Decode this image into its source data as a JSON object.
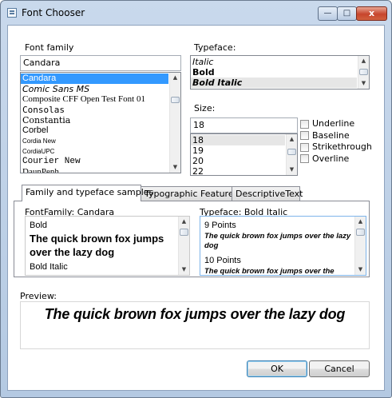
{
  "window": {
    "title": "Font Chooser",
    "minimize_glyph": "—",
    "maximize_glyph": "□",
    "close_glyph": "x"
  },
  "font_family": {
    "label": "Font family",
    "value": "Candara",
    "items": [
      {
        "text": "Candara",
        "font": "\"Liberation Sans\", sans-serif",
        "selected": true
      },
      {
        "text": "Comic Sans MS",
        "font": "\"DejaVu Sans\", sans-serif",
        "selected": false
      },
      {
        "text": "Composite CFF Open Test Font 01",
        "font": "\"Liberation Serif\", serif",
        "selected": false
      },
      {
        "text": "Consolas",
        "font": "\"DejaVu Sans Mono\", monospace",
        "selected": false
      },
      {
        "text": "Constantia",
        "font": "\"DejaVu Serif\", serif",
        "selected": false
      },
      {
        "text": "Corbel",
        "font": "\"Liberation Sans\", sans-serif",
        "selected": false
      },
      {
        "text": "Cordia New",
        "font": "\"Liberation Sans\", sans-serif",
        "selected": false
      },
      {
        "text": "CordiaUPC",
        "font": "\"Liberation Sans\", sans-serif",
        "selected": false
      },
      {
        "text": "Courier New",
        "font": "\"Liberation Mono\", monospace",
        "selected": false
      },
      {
        "text": "DaunPenh",
        "font": "\"Liberation Serif\", serif",
        "selected": false
      }
    ]
  },
  "typeface": {
    "label": "Typeface:",
    "items": [
      {
        "text": "Italic",
        "style": "italic",
        "selected": false
      },
      {
        "text": "Bold",
        "style": "bold",
        "selected": false
      },
      {
        "text": "Bold Italic",
        "style": "bolditalic",
        "selected": true
      }
    ]
  },
  "size": {
    "label": "Size:",
    "value": "18",
    "items": [
      {
        "text": "18",
        "selected": true
      },
      {
        "text": "19",
        "selected": false
      },
      {
        "text": "20",
        "selected": false
      },
      {
        "text": "22",
        "selected": false
      }
    ]
  },
  "decorations": [
    {
      "label": "Underline",
      "checked": false
    },
    {
      "label": "Baseline",
      "checked": false
    },
    {
      "label": "Strikethrough",
      "checked": false
    },
    {
      "label": "Overline",
      "checked": false
    }
  ],
  "tabs": [
    {
      "label": "Family and typeface samples",
      "active": true
    },
    {
      "label": "Typographic Features",
      "active": false
    },
    {
      "label": "DescriptiveText",
      "active": false
    }
  ],
  "samples": {
    "family_label": "FontFamily: Candara",
    "family_items": [
      {
        "text": "Bold",
        "kind": "caption"
      },
      {
        "text": "The quick brown fox jumps over the lazy dog",
        "kind": "sample-bold"
      },
      {
        "text": "Bold Italic",
        "kind": "caption"
      }
    ],
    "typeface_label": "Typeface: Bold Italic",
    "typeface_items": [
      {
        "text": "9 Points",
        "kind": "caption"
      },
      {
        "text": "The quick brown fox jumps over the lazy dog",
        "kind": "sample-small"
      },
      {
        "text": "10 Points",
        "kind": "caption"
      },
      {
        "text": "The quick brown fox jumps over the",
        "kind": "sample-small"
      }
    ]
  },
  "preview": {
    "label": "Preview:",
    "text": "The quick brown fox jumps over the lazy dog"
  },
  "buttons": {
    "ok": "OK",
    "cancel": "Cancel"
  }
}
